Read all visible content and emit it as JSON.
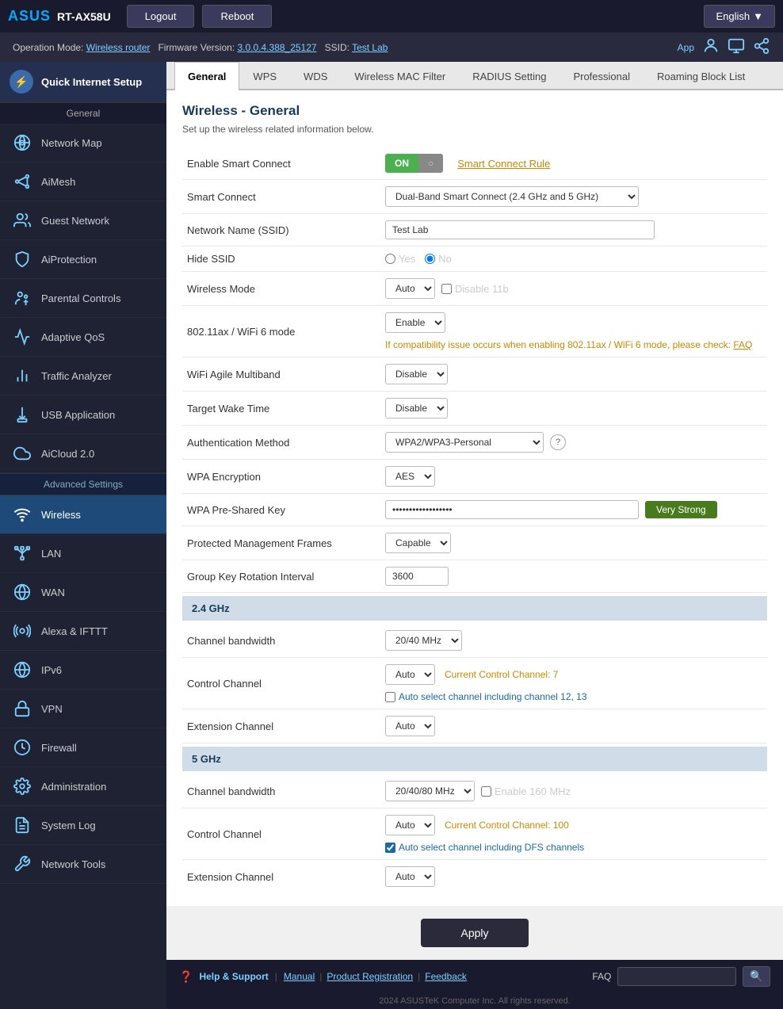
{
  "header": {
    "logo_asus": "ASUS",
    "logo_model": "RT-AX58U",
    "btn_logout": "Logout",
    "btn_reboot": "Reboot",
    "btn_language": "English"
  },
  "infobar": {
    "operation_mode_label": "Operation Mode:",
    "operation_mode_value": "Wireless router",
    "firmware_label": "Firmware Version:",
    "firmware_value": "3.0.0.4.388_25127",
    "ssid_label": "SSID:",
    "ssid_value": "Test Lab",
    "app_label": "App"
  },
  "sidebar": {
    "quick_setup_label": "Quick Internet Setup",
    "general_label": "General",
    "items_general": [
      {
        "label": "Network Map",
        "id": "network-map"
      },
      {
        "label": "AiMesh",
        "id": "aimesh"
      },
      {
        "label": "Guest Network",
        "id": "guest-network"
      },
      {
        "label": "AiProtection",
        "id": "aiprotection"
      },
      {
        "label": "Parental Controls",
        "id": "parental-controls"
      },
      {
        "label": "Adaptive QoS",
        "id": "adaptive-qos"
      },
      {
        "label": "Traffic Analyzer",
        "id": "traffic-analyzer"
      },
      {
        "label": "USB Application",
        "id": "usb-application"
      },
      {
        "label": "AiCloud 2.0",
        "id": "aicloud"
      }
    ],
    "advanced_label": "Advanced Settings",
    "items_advanced": [
      {
        "label": "Wireless",
        "id": "wireless",
        "active": true
      },
      {
        "label": "LAN",
        "id": "lan"
      },
      {
        "label": "WAN",
        "id": "wan"
      },
      {
        "label": "Alexa & IFTTT",
        "id": "alexa"
      },
      {
        "label": "IPv6",
        "id": "ipv6"
      },
      {
        "label": "VPN",
        "id": "vpn"
      },
      {
        "label": "Firewall",
        "id": "firewall"
      },
      {
        "label": "Administration",
        "id": "administration"
      },
      {
        "label": "System Log",
        "id": "system-log"
      },
      {
        "label": "Network Tools",
        "id": "network-tools"
      }
    ]
  },
  "tabs": [
    {
      "label": "General",
      "active": true
    },
    {
      "label": "WPS"
    },
    {
      "label": "WDS"
    },
    {
      "label": "Wireless MAC Filter"
    },
    {
      "label": "RADIUS Setting"
    },
    {
      "label": "Professional"
    },
    {
      "label": "Roaming Block List"
    }
  ],
  "content": {
    "page_title": "Wireless - General",
    "page_desc": "Set up the wireless related information below.",
    "fields": {
      "enable_smart_connect_label": "Enable Smart Connect",
      "toggle_on": "ON",
      "smart_connect_rule_link": "Smart Connect Rule",
      "smart_connect_label": "Smart Connect",
      "smart_connect_value": "Dual-Band Smart Connect (2.4 GHz and 5 GHz)",
      "network_name_label": "Network Name (SSID)",
      "network_name_value": "Test Lab",
      "hide_ssid_label": "Hide SSID",
      "hide_ssid_yes": "Yes",
      "hide_ssid_no": "No",
      "wireless_mode_label": "Wireless Mode",
      "wireless_mode_value": "Auto",
      "disable_11b_label": "Disable 11b",
      "wifi6_label": "802.11ax / WiFi 6 mode",
      "wifi6_value": "Enable",
      "wifi6_warning": "If compatibility issue occurs when enabling 802.11ax / WiFi 6 mode, please check:",
      "wifi6_faq_link": "FAQ",
      "wifi_agile_label": "WiFi Agile Multiband",
      "wifi_agile_value": "Disable",
      "target_wake_label": "Target Wake Time",
      "target_wake_value": "Disable",
      "auth_method_label": "Authentication Method",
      "auth_method_value": "WPA2/WPA3-Personal",
      "wpa_encryption_label": "WPA Encryption",
      "wpa_encryption_value": "AES",
      "wpa_key_label": "WPA Pre-Shared Key",
      "wpa_key_value": "••••••••••••••••••••••••••••••",
      "wpa_strength": "Very Strong",
      "pmf_label": "Protected Management Frames",
      "pmf_value": "Capable",
      "group_key_label": "Group Key Rotation Interval",
      "group_key_value": "3600",
      "band_24_header": "2.4 GHz",
      "band_24_channel_bw_label": "Channel bandwidth",
      "band_24_channel_bw_value": "20/40 MHz",
      "band_24_control_channel_label": "Control Channel",
      "band_24_control_channel_value": "Auto",
      "band_24_current_channel": "Current Control Channel: 7",
      "band_24_auto_select": "Auto select channel including channel 12, 13",
      "band_24_ext_channel_label": "Extension Channel",
      "band_24_ext_channel_value": "Auto",
      "band_5_header": "5 GHz",
      "band_5_channel_bw_label": "Channel bandwidth",
      "band_5_channel_bw_value": "20/40/80 MHz",
      "band_5_enable_160_label": "Enable 160 MHz",
      "band_5_control_channel_label": "Control Channel",
      "band_5_control_channel_value": "Auto",
      "band_5_current_channel": "Current Control Channel: 100",
      "band_5_auto_dfs": "Auto select channel including DFS channels",
      "band_5_ext_channel_label": "Extension Channel",
      "band_5_ext_channel_value": "Auto"
    },
    "apply_btn": "Apply"
  },
  "footer": {
    "help_label": "Help & Support",
    "manual_link": "Manual",
    "product_reg_link": "Product Registration",
    "feedback_link": "Feedback",
    "faq_label": "FAQ",
    "search_placeholder": "",
    "copyright": "2024 ASUSTeK Computer Inc. All rights reserved."
  }
}
